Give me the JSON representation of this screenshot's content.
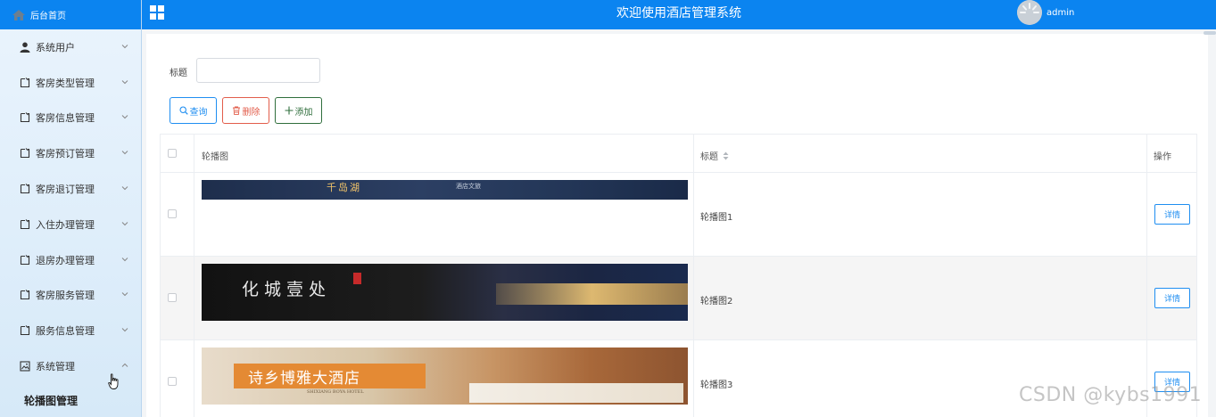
{
  "header": {
    "home_label": "后台首页",
    "title": "欢迎使用酒店管理系统",
    "user": "admin"
  },
  "sidebar": {
    "items": [
      {
        "label": "系统用户",
        "icon": "user-icon",
        "expanded": false
      },
      {
        "label": "客房类型管理",
        "icon": "document-icon",
        "expanded": false
      },
      {
        "label": "客房信息管理",
        "icon": "document-icon",
        "expanded": false
      },
      {
        "label": "客房预订管理",
        "icon": "document-icon",
        "expanded": false
      },
      {
        "label": "客房退订管理",
        "icon": "document-icon",
        "expanded": false
      },
      {
        "label": "入住办理管理",
        "icon": "document-icon",
        "expanded": false
      },
      {
        "label": "退房办理管理",
        "icon": "document-icon",
        "expanded": false
      },
      {
        "label": "客房服务管理",
        "icon": "document-icon",
        "expanded": false
      },
      {
        "label": "服务信息管理",
        "icon": "document-icon",
        "expanded": false
      },
      {
        "label": "系统管理",
        "icon": "image-icon",
        "expanded": true
      }
    ],
    "sub_item": "轮播图管理"
  },
  "search": {
    "label": "标题",
    "value": ""
  },
  "buttons": {
    "search": "查询",
    "delete": "删除",
    "add": "添加"
  },
  "table": {
    "headers": {
      "image": "轮播图",
      "title": "标题",
      "actions": "操作"
    },
    "rows": [
      {
        "title": "轮播图1",
        "action": "详情",
        "image_text": "千岛湖",
        "image_text2": "酒店文旅"
      },
      {
        "title": "轮播图2",
        "action": "详情",
        "image_text": "化城壹处",
        "image_text2": ""
      },
      {
        "title": "轮播图3",
        "action": "详情",
        "image_text": "诗乡博雅大酒店",
        "image_text2": "SHIXIANG BOYA HOTEL"
      }
    ]
  },
  "watermark": "CSDN @kybs1991",
  "colors": {
    "primary": "#0b84f0",
    "sidebar_bg": "#e3f0fb",
    "danger": "#e25d4b",
    "success": "#2f6e3c"
  }
}
